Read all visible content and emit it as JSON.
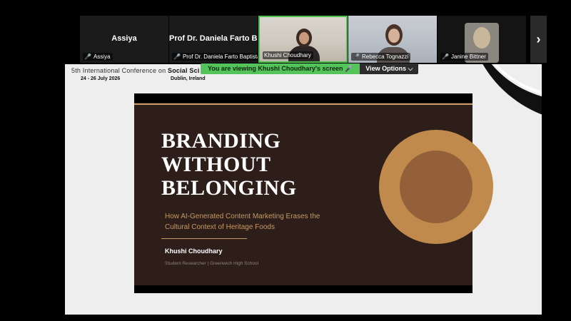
{
  "participants": [
    {
      "big_name": "Assiya",
      "label": "Assiya"
    },
    {
      "big_name": "Prof Dr. Daniela Farto B...",
      "label": "Prof Dr. Daniela Farto Baptista"
    },
    {
      "big_name": "",
      "label": "Khushi Choudhary"
    },
    {
      "big_name": "",
      "label": "Rebecca Tognazzi"
    },
    {
      "big_name": "",
      "label": "Janine Bittner"
    }
  ],
  "strip": {
    "next_icon": "chevron-right-icon",
    "next_glyph": "›",
    "mic_glyph": "🎤"
  },
  "banner": {
    "viewing_text": "You are viewing  Khushi Choudhary's screen  🎤",
    "options_label": "View Options ⌵"
  },
  "conference": {
    "title_plain": "5th International Conference on ",
    "title_bold": "Social Sci",
    "dates": "24 - 26 July 2026",
    "location": "Dublin, Ireland"
  },
  "slide": {
    "title_lines": [
      "BRANDING",
      "WITHOUT",
      "BELONGING"
    ],
    "subtitle": "How AI-Generated Content Marketing Erases the Cultural Context of Heritage Foods",
    "author": "Khushi Choudhary",
    "role": "Student Researcher   |   Greenwich High School"
  },
  "colors": {
    "active_tile_border": "#4cc24a",
    "banner_green": "#53c35a",
    "slide_bg": "#2d1e1a",
    "slide_accent": "#c59a64",
    "circle_outer": "#c18a4d",
    "circle_inner": "#94603a"
  }
}
